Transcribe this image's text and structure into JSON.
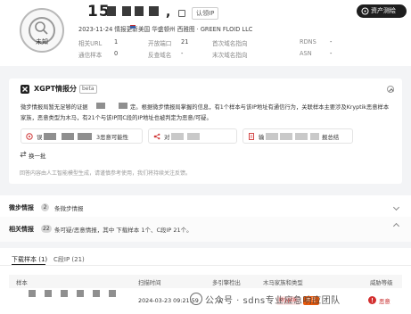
{
  "header": {
    "ip_fragment": "15",
    "verdict_label": "未知",
    "claim_label": "认领IP",
    "fiddle_label": "资产测绘",
    "date_meta": "2023-11-24 情报更新",
    "location_org": "美国 华盛顿州 西雅图 · GREEN FLOID LLC",
    "stats": [
      {
        "key": "相关URL",
        "val": "1"
      },
      {
        "key": "开放端口",
        "val": "21"
      },
      {
        "key": "首次域名指向",
        "val": ""
      },
      {
        "key": "RDNS",
        "val": "-"
      },
      {
        "key": "通信样本",
        "val": "0"
      },
      {
        "key": "反查域名",
        "val": "-"
      },
      {
        "key": "末次域名指向",
        "val": ""
      },
      {
        "key": "ASN",
        "val": "-"
      }
    ]
  },
  "xgpt": {
    "title": "XGPT情报分",
    "beta": "beta",
    "line1a": "微步情报局暂无足够的证据",
    "line1b": "定。根据微步情报局掌握的信息，有1个样本与该IP地址有通信行为，关联样本主要涉及Kryptik恶意样本",
    "line2": "家族，恶意类型为木马，有21个与该IP同C段的IP地址也被判定为恶意/可疑。",
    "pills": [
      {
        "a": "误",
        "b": "3恶意可能性"
      },
      {
        "a": "对",
        "b": ""
      },
      {
        "a": "输",
        "b": "报总结"
      }
    ],
    "more": "换一批",
    "footnote": "回答内容由人工智能模型生成，请谨慎参考使用，我们将持续关注反馈。"
  },
  "rows": [
    {
      "title": "微步情报",
      "count": "2",
      "desc": "条微步情报"
    },
    {
      "title": "相关情报",
      "count": "22",
      "desc": "条可疑/恶意情报，其中 下载样本 1个、C段IP 21个。"
    }
  ],
  "tabs": {
    "t1": "下载样本 (1)",
    "t2": "C段IP (21)"
  },
  "table": {
    "headers": [
      "样本",
      "扫描时间",
      "多引擎检出",
      "木马家族和类型",
      "威胁等级"
    ],
    "row": {
      "time": "2024-03-23 09:21:59",
      "engine": "3/",
      "tag1": "Kryptik",
      "tag2": "木马",
      "level": "恶意"
    }
  },
  "watermark": "公众号 · sdns专业应急响应团队"
}
